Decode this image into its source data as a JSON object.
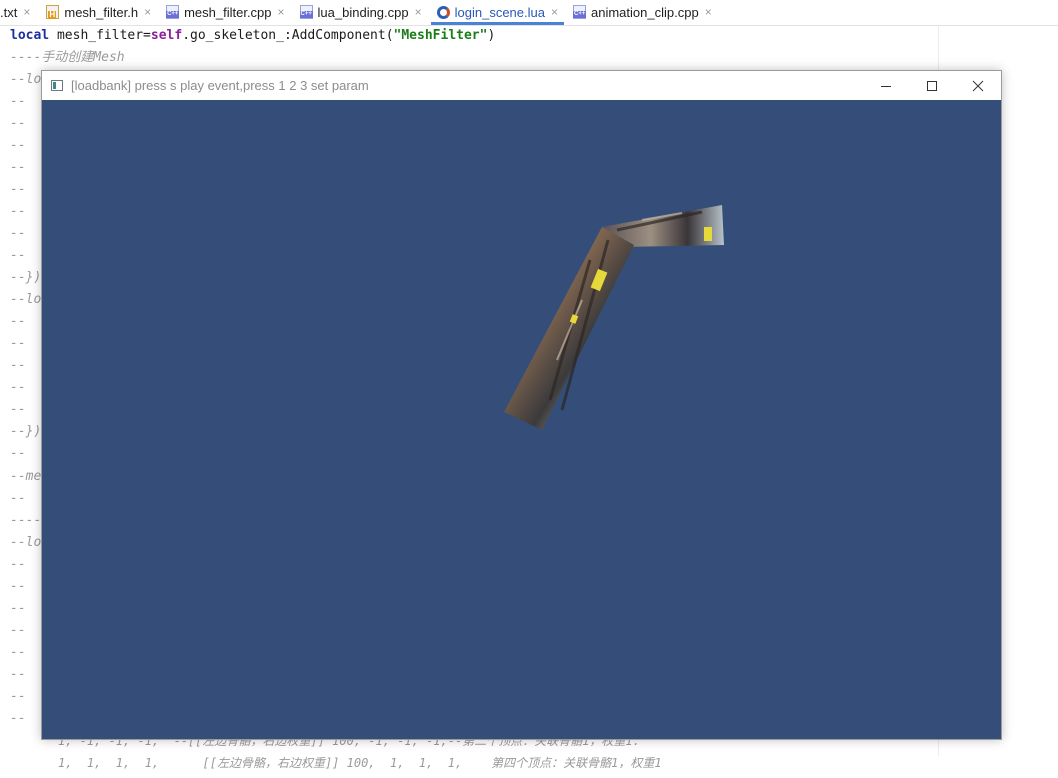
{
  "tabs": [
    {
      "label": ".txt",
      "icon": "none",
      "active": false
    },
    {
      "label": "mesh_filter.h",
      "icon": "h",
      "active": false
    },
    {
      "label": "mesh_filter.cpp",
      "icon": "cpp",
      "active": false
    },
    {
      "label": "lua_binding.cpp",
      "icon": "cpp",
      "active": false
    },
    {
      "label": "login_scene.lua",
      "icon": "lua",
      "active": true
    },
    {
      "label": "animation_clip.cpp",
      "icon": "cpp",
      "active": false
    }
  ],
  "tab_close_glyph": "×",
  "editor": {
    "line1": {
      "keyword": "local",
      "part1": " mesh_filter=",
      "self": "self",
      "part2": ".go_skeleton_:AddComponent(",
      "string": "\"MeshFilter\"",
      "part3": ")"
    },
    "line2": "----手动创建Mesh",
    "prefixes": [
      "--lo",
      "--",
      "--",
      "--",
      "--",
      "--",
      "--",
      "--",
      "--",
      "--})",
      "--lo",
      "--",
      "--",
      "--",
      "--",
      "--",
      "--})",
      "--",
      "--me",
      "--",
      "----",
      "--lo",
      "--",
      "--",
      "--",
      "--",
      "--",
      "--",
      "--",
      "--"
    ],
    "peek_line1": "1, -1, -1, -1,  --[[左边骨骼，右边权重]] 100, -1, -1, -1,--第二个顶点：关联骨骼1，权重1.",
    "peek_line2": "1,  1,  1,  1,      [[左边骨骼，右边权重]] 100,  1,  1,  1,    第四个顶点：关联骨骼1，权重1"
  },
  "window": {
    "title": "[loadbank] press s play event,press 1 2 3 set param",
    "minimize": "─",
    "maximize": "☐",
    "close": "✕",
    "background": "#344e79"
  }
}
